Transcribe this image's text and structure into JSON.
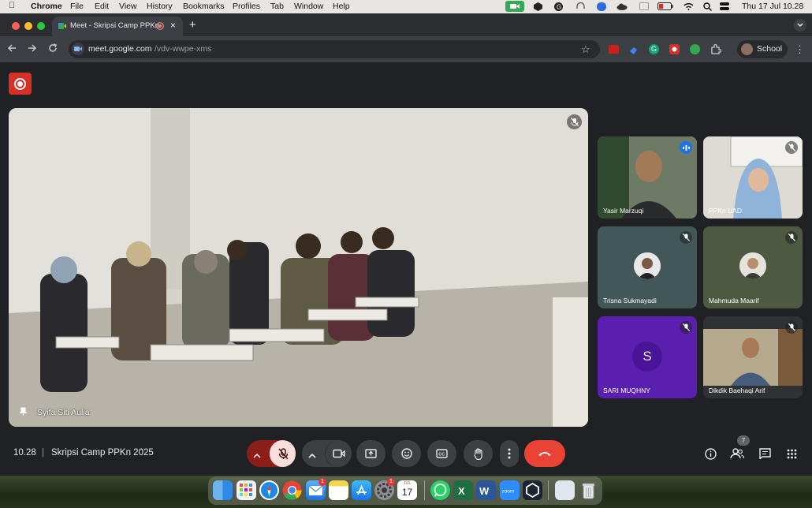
{
  "menubar": {
    "app": "Chrome",
    "items": [
      "File",
      "Edit",
      "View",
      "History",
      "Bookmarks",
      "Profiles",
      "Tab",
      "Window",
      "Help"
    ],
    "datetime": "Thu 17 Jul  10.28"
  },
  "tab": {
    "title": "Meet - Skripsi Camp PPKn",
    "close": "×",
    "new_tab": "+"
  },
  "address": {
    "domain": "meet.google.com",
    "path": "/vdv-wwpe-xms"
  },
  "profile": {
    "label": "School"
  },
  "main_video": {
    "name": "Syifa Siti Aulia"
  },
  "participants": [
    {
      "name": "Yasir Marzuqi",
      "speaking": true
    },
    {
      "name": "PPKn UAD",
      "muted": true
    },
    {
      "name": "Trisna Sukmayadi",
      "muted": true
    },
    {
      "name": "Mahmuda Maarif",
      "muted": true
    },
    {
      "name": "SARI MUQHNY",
      "initial": "S",
      "muted": true
    },
    {
      "name": "Dikdik Baehaqi Arif",
      "muted": true
    }
  ],
  "meeting": {
    "time": "10.28",
    "separator": "|",
    "title": "Skripsi Camp PPKn 2025",
    "people_count": "7"
  },
  "dock": {
    "calendar_month": "JUL",
    "calendar_day": "17",
    "mail_badge": "1",
    "settings_badge": "1"
  },
  "colors": {
    "end_call": "#ea4335",
    "muted": "#f9dedc",
    "record": "#d93025",
    "meet_bg": "#202124"
  }
}
